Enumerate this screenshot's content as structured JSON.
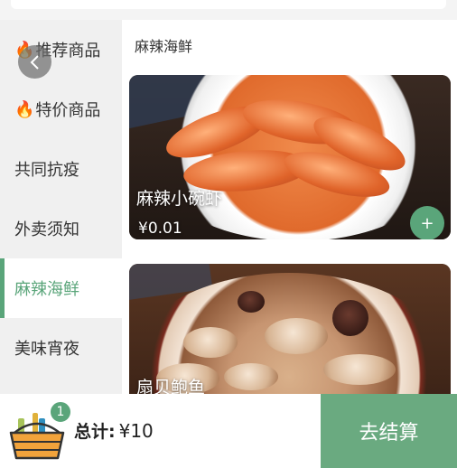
{
  "sidebar": {
    "items": [
      {
        "emoji": "🔥",
        "label": "推荐商品",
        "active": false
      },
      {
        "emoji": "🔥",
        "label": "特价商品",
        "active": false
      },
      {
        "emoji": "",
        "label": "共同抗疫",
        "active": false
      },
      {
        "emoji": "",
        "label": "外卖须知",
        "active": false
      },
      {
        "emoji": "",
        "label": "麻辣海鲜",
        "active": true
      },
      {
        "emoji": "",
        "label": "美味宵夜",
        "active": false
      }
    ]
  },
  "main": {
    "section_title": "麻辣海鲜",
    "products": [
      {
        "name": "麻辣小碗虾",
        "price": "¥0.01",
        "add_icon": "+"
      },
      {
        "name": "扇贝鲍鱼"
      }
    ]
  },
  "cart": {
    "badge_count": "1",
    "total_label": "总计:",
    "total_value": "¥10",
    "checkout_label": "去结算"
  },
  "icons": {
    "back": "chevron-left-icon",
    "basket": "shopping-basket-icon",
    "add": "plus-icon"
  },
  "colors": {
    "accent": "#5aa57a",
    "checkout": "#6aaa80"
  }
}
